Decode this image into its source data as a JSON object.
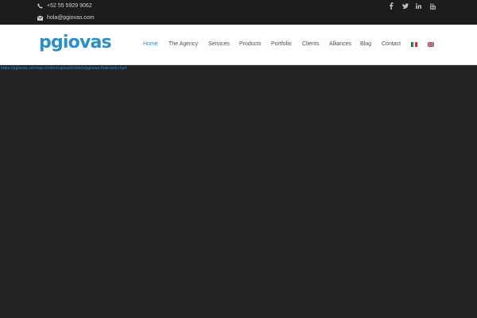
{
  "topbar": {
    "phone": "+52 55 5929 9062",
    "email": "hola@pgiovas.com",
    "phone_icon": "phone-icon",
    "email_icon": "envelope-icon",
    "social_icons": [
      "facebook-icon",
      "twitter-icon",
      "linkedin-icon",
      "youtube-icon"
    ]
  },
  "header": {
    "logo": "pgiovas",
    "nav": [
      {
        "label": "Home",
        "active": true
      },
      {
        "label": "The Agency",
        "active": false
      },
      {
        "label": "Services",
        "active": false
      },
      {
        "label": "Products",
        "active": false
      },
      {
        "label": "Portfolio",
        "active": false
      },
      {
        "label": "Clients",
        "active": false
      },
      {
        "label": "Alliances",
        "active": false
      },
      {
        "label": "Blog",
        "active": false
      },
      {
        "label": "Contact",
        "active": false
      }
    ],
    "languages": [
      "mexico-flag-icon",
      "uk-flag-icon"
    ]
  },
  "video": {
    "source_link": "https://pgiovas.com/wp-content/uploads/video/pgiovas-final-web.mp4"
  },
  "colors": {
    "accent": "#2a8ec9",
    "topbar_bg": "#1c1c1c",
    "page_bg": "#232323",
    "header_bg": "#ffffff"
  }
}
